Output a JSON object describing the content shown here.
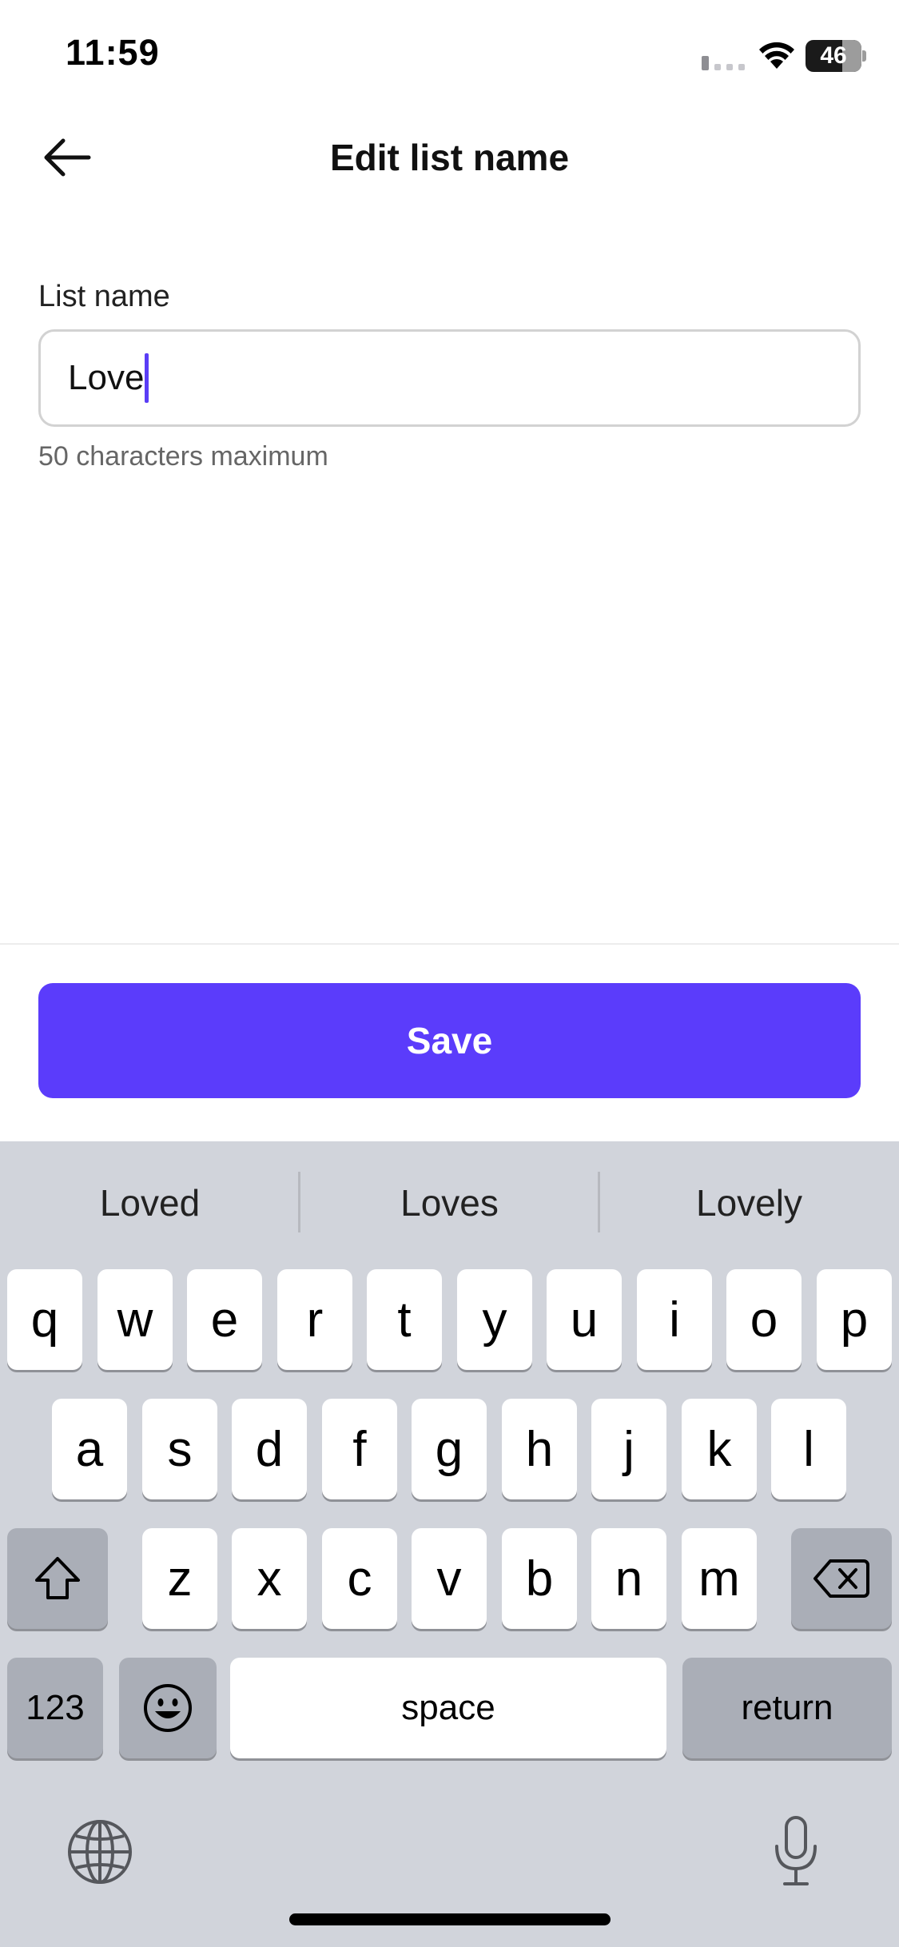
{
  "status_bar": {
    "time": "11:59",
    "battery": "46"
  },
  "header": {
    "title": "Edit list name",
    "back_icon": "arrow-left-icon"
  },
  "form": {
    "label": "List name",
    "value": "Love",
    "helper": "50 characters maximum"
  },
  "save_label": "Save",
  "colors": {
    "accent": "#5b3cfb",
    "keyboard_bg": "#d1d4db"
  },
  "keyboard": {
    "suggestions": [
      "Loved",
      "Loves",
      "Lovely"
    ],
    "row1": [
      "q",
      "w",
      "e",
      "r",
      "t",
      "y",
      "u",
      "i",
      "o",
      "p"
    ],
    "row2": [
      "a",
      "s",
      "d",
      "f",
      "g",
      "h",
      "j",
      "k",
      "l"
    ],
    "row3": [
      "z",
      "x",
      "c",
      "v",
      "b",
      "n",
      "m"
    ],
    "numbers_key": "123",
    "space_key": "space",
    "return_key": "return",
    "icons": {
      "shift": "shift-icon",
      "delete": "backspace-icon",
      "emoji": "emoji-icon",
      "globe": "globe-icon",
      "mic": "microphone-icon"
    }
  }
}
